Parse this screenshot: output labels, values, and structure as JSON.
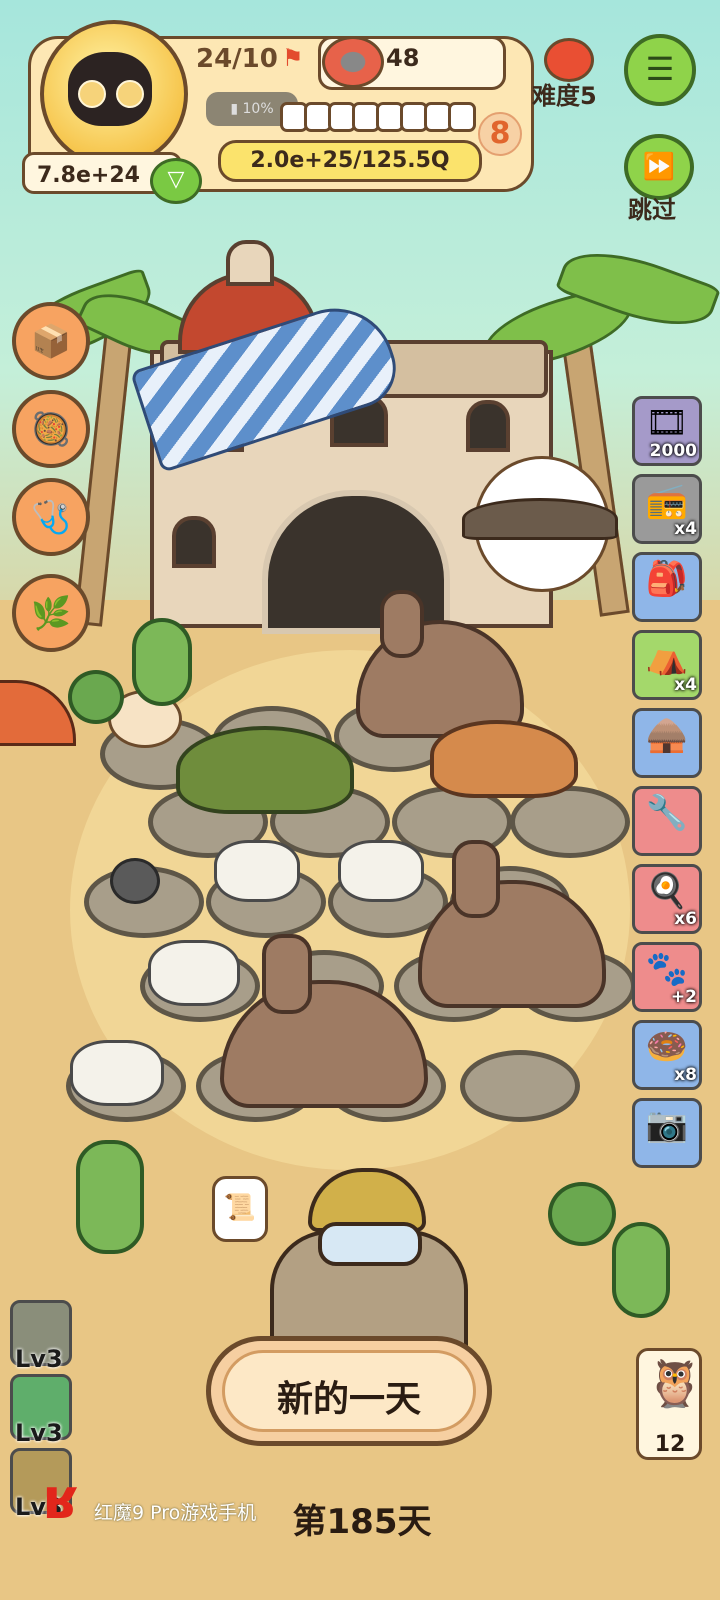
{
  "hud": {
    "days_progress": "24/10",
    "food_count": "48",
    "battery_text": "10%",
    "level": "8",
    "exp_text": "2.0e+25/125.5Q",
    "money": "7.8e+24",
    "difficulty": "难度5",
    "skip_label": "跳过",
    "progress_segments_total": 8,
    "progress_segments_filled": 0
  },
  "shop": {
    "items": [
      {
        "name": "film-reel",
        "count": "2000",
        "glyph": "🎞"
      },
      {
        "name": "walkie-talkie",
        "count": "x4",
        "glyph": "📻"
      },
      {
        "name": "sack",
        "count": "",
        "glyph": "🎒"
      },
      {
        "name": "tent",
        "count": "x4",
        "glyph": "⛺"
      },
      {
        "name": "hut",
        "count": "",
        "glyph": "🛖"
      },
      {
        "name": "tools",
        "count": "",
        "glyph": "🔧"
      },
      {
        "name": "pot",
        "count": "x6",
        "glyph": "🍳"
      },
      {
        "name": "paw-plus",
        "count": "+2",
        "glyph": "🐾"
      },
      {
        "name": "donut",
        "count": "x8",
        "glyph": "🍩"
      },
      {
        "name": "camera",
        "count": "",
        "glyph": "📷"
      }
    ]
  },
  "level_cards": [
    {
      "label": "Lv3"
    },
    {
      "label": "Lv3"
    },
    {
      "label": "Lv3"
    }
  ],
  "owl_count": "12",
  "buttons": {
    "new_day": "新的一天"
  },
  "footer": {
    "day_label": "第185天",
    "watermark": "红魔9 Pro游戏手机"
  },
  "colors": {
    "accent_green": "#8fd34a",
    "hud_border": "#6b4a2b",
    "exp_bar": "#fbe36c",
    "button_orange": "#f7a361"
  }
}
